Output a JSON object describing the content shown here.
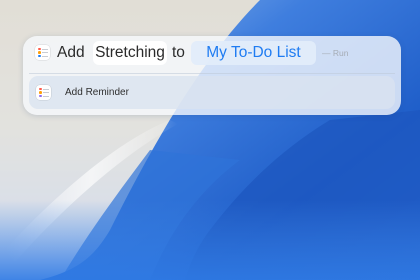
{
  "query": {
    "verb": "Add",
    "item_token": "Stretching",
    "connector": "to",
    "list_token": "My To-Do List",
    "run_hint": "— Run"
  },
  "result": {
    "label": "Add Reminder"
  },
  "icons": {
    "app_icon": "reminders-app-icon"
  },
  "colors": {
    "accent": "#1f7cf2",
    "icon_dot_red": "#ff5b4a",
    "icon_dot_orange": "#ff9f0a",
    "icon_dot_blue": "#1f7cf2",
    "icon_dot_purple": "#8e6cf0",
    "wallpaper_blue": "#1e5ec4"
  }
}
